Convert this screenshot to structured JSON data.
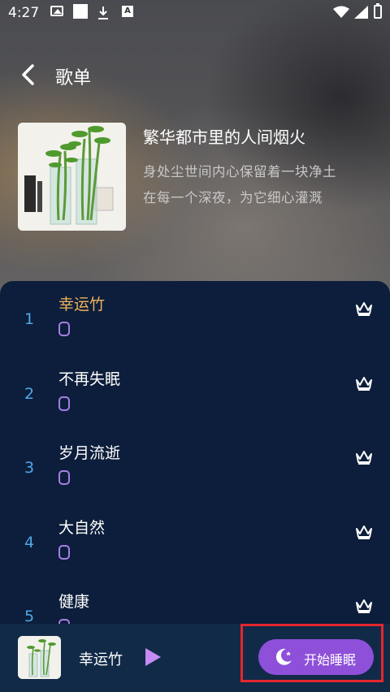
{
  "status_bar": {
    "time": "4:27",
    "icons": [
      "image-icon",
      "square-icon",
      "download-icon",
      "a-box-icon",
      "wifi-icon",
      "cellular-icon",
      "battery-icon"
    ]
  },
  "header": {
    "title": "歌单",
    "back_icon": "chevron-left-icon"
  },
  "playlist": {
    "title": "繁华都市里的人间烟火",
    "description_line1": "身处尘世间内心保留着一块净土",
    "description_line2": "在每一个深夜，为它细心灌溉"
  },
  "songs": [
    {
      "index": "1",
      "title": "幸运竹",
      "active": true
    },
    {
      "index": "2",
      "title": "不再失眠",
      "active": false
    },
    {
      "index": "3",
      "title": "岁月流逝",
      "active": false
    },
    {
      "index": "4",
      "title": "大自然",
      "active": false
    },
    {
      "index": "5",
      "title": "健康",
      "active": false
    }
  ],
  "player": {
    "now_playing": "幸运竹",
    "sleep_button_label": "开始睡眠"
  },
  "colors": {
    "panel_bg": "#0c1e3b",
    "player_bg": "#112a48",
    "accent_purple": "#8e4fd9",
    "active_title": "#f0b25c",
    "index_blue": "#4fa8e8",
    "highlight_red": "#e5262e"
  }
}
